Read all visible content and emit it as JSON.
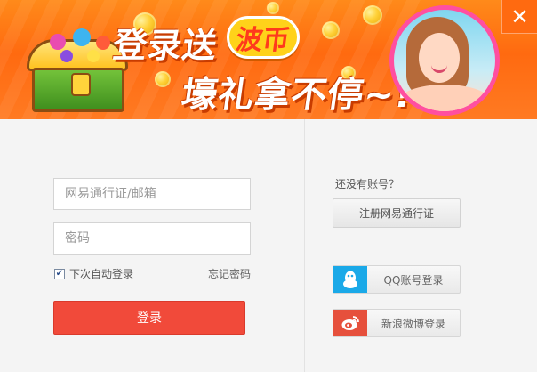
{
  "banner": {
    "slogan_line1": "登录送",
    "slogan_badge": "波币",
    "slogan_line2": "壕礼拿不停~!"
  },
  "window": {
    "close_label": "✕"
  },
  "login_form": {
    "username_placeholder": "网易通行证/邮箱",
    "password_placeholder": "密码",
    "remember_checked": true,
    "remember_label": "下次自动登录",
    "forgot_label": "忘记密码",
    "login_label": "登录"
  },
  "register": {
    "prompt": "还没有账号？",
    "button_label": "注册网易通行证"
  },
  "social_login": [
    {
      "icon": "qq-penguin-icon",
      "label": "QQ账号登录",
      "color": "#1aa9e8"
    },
    {
      "icon": "weibo-icon",
      "label": "新浪微博登录",
      "color": "#e6503c"
    }
  ],
  "colors": {
    "banner_orange": "#ff7a1a",
    "login_red": "#f14a3a",
    "avatar_ring_pink": "#ff4fa0"
  }
}
